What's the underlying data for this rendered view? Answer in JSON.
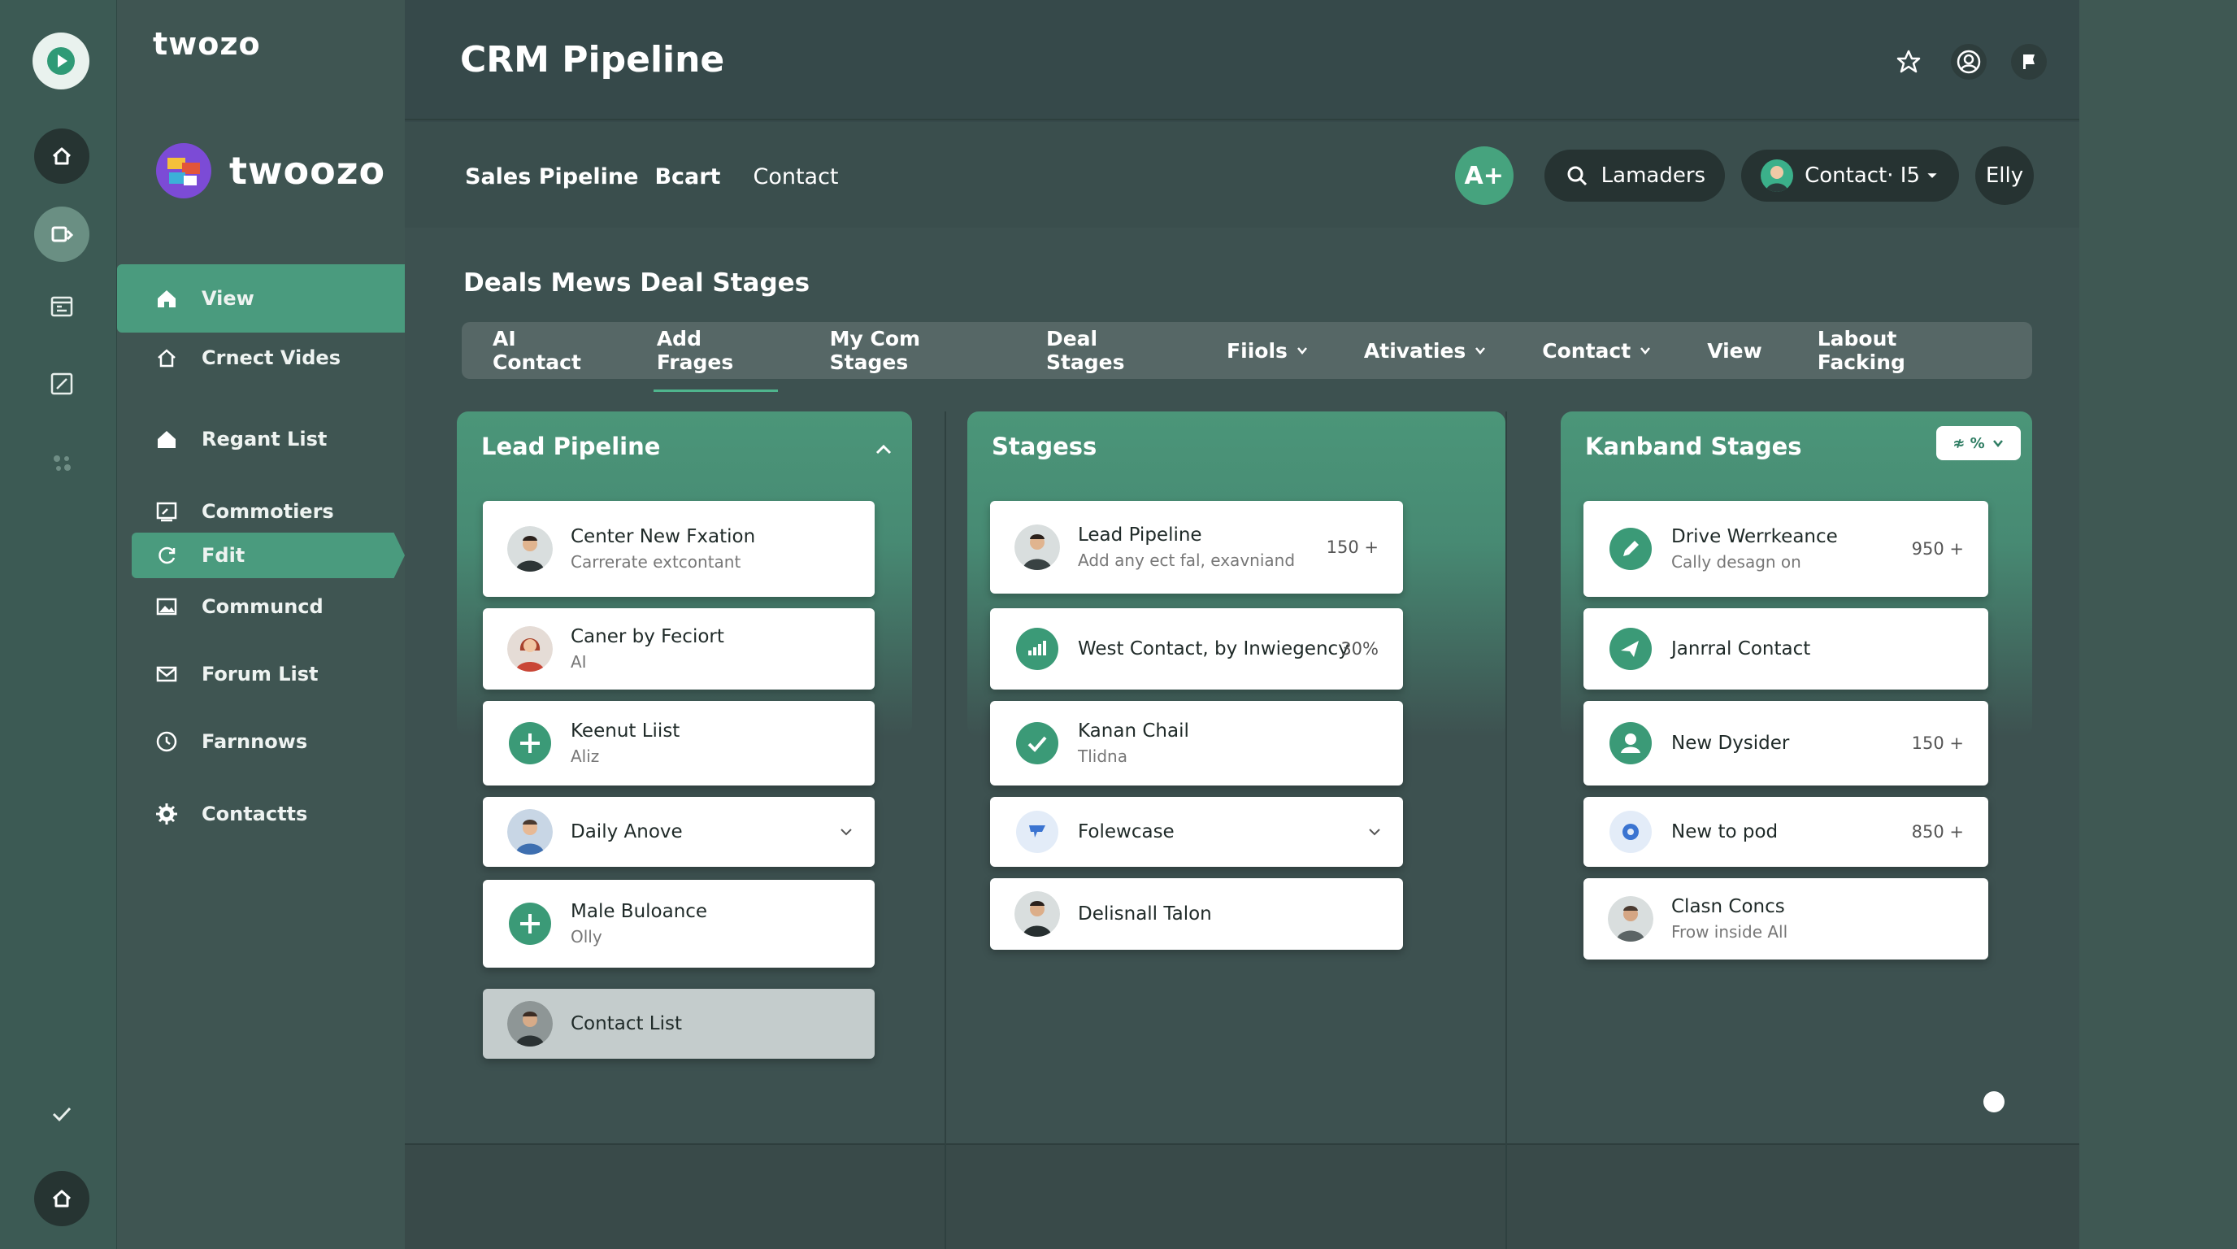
{
  "rail": {
    "icons": [
      "play-icon",
      "home-icon",
      "contacts-card-icon",
      "calendar-icon",
      "edit-icon",
      "dots-icon",
      "check-icon",
      "home-icon"
    ]
  },
  "sidebar": {
    "top_brand": "twozo",
    "brand": "twoozo",
    "items": [
      {
        "label": "View",
        "icon": "home-icon"
      },
      {
        "label": "Crnect Vides",
        "icon": "house-outline-icon"
      },
      {
        "label": "Regant List",
        "icon": "house-filled-icon"
      },
      {
        "label": "Commotiers",
        "icon": "board-icon"
      },
      {
        "label": "Fdit",
        "icon": "refresh-icon"
      },
      {
        "label": "Communcd",
        "icon": "image-icon"
      },
      {
        "label": "Forum List",
        "icon": "mail-icon"
      },
      {
        "label": "Farnnows",
        "icon": "clock-icon"
      },
      {
        "label": "Contactts",
        "icon": "gear-icon"
      }
    ]
  },
  "header": {
    "title": "CRM Pipeline",
    "icons": [
      "star-icon",
      "user-circle-icon",
      "flag-icon"
    ]
  },
  "subbar": {
    "links": [
      "Sales Pipeline",
      "Bcart",
      "Contact"
    ],
    "add_label": "A+",
    "search_label": "Lamaders",
    "contact_label": "Contact· I5",
    "user_label": "Elly"
  },
  "main": {
    "section_title": "Deals Mews Deal Stages",
    "tabs": [
      {
        "label": "AI Contact",
        "dropdown": false
      },
      {
        "label": "Add Frages",
        "dropdown": false,
        "active": true
      },
      {
        "label": "My Com Stages",
        "dropdown": false
      },
      {
        "label": "Deal Stages",
        "dropdown": false
      },
      {
        "label": "Fiiols",
        "dropdown": true
      },
      {
        "label": "Ativaties",
        "dropdown": true
      },
      {
        "label": "Contact",
        "dropdown": true
      },
      {
        "label": "View",
        "dropdown": false
      },
      {
        "label": "Labout Facking",
        "dropdown": false
      }
    ]
  },
  "columns": [
    {
      "title": "Lead Pipeline",
      "cards": [
        {
          "title": "Center New Fxation",
          "subtitle": "Carrerate extcontant",
          "icon": "avatar-man-icon"
        },
        {
          "title": "Caner by Feciort",
          "subtitle": "AI",
          "icon": "avatar-woman-icon"
        },
        {
          "title": "Keenut Liist",
          "subtitle": "Aliz",
          "icon": "plus-circle-icon"
        },
        {
          "title": "Daily Anove",
          "subtitle": "",
          "icon": "avatar-man-blue-icon",
          "dropdown": true
        },
        {
          "title": "Male Buloance",
          "subtitle": "Olly",
          "icon": "plus-circle-icon"
        },
        {
          "title": "Contact List",
          "subtitle": "",
          "icon": "avatar-man-icon"
        }
      ]
    },
    {
      "title": "Stagess",
      "cards": [
        {
          "title": "Lead Pipeline",
          "subtitle": "Add any ect fal, exavniand",
          "meta": "150 +",
          "icon": "avatar-man-icon"
        },
        {
          "title": "West Contact, by Inwiegency",
          "subtitle": "",
          "meta": "30%",
          "icon": "bar-chart-icon"
        },
        {
          "title": "Kanan Chail",
          "subtitle": "Tlidna",
          "icon": "check-circle-icon"
        },
        {
          "title": "Folewcase",
          "subtitle": "",
          "icon": "chat-icon",
          "dropdown": true
        },
        {
          "title": "Delisnall Talon",
          "subtitle": "",
          "icon": "avatar-man-icon"
        }
      ]
    },
    {
      "title": "Kanband Stages",
      "filter_label": "≉ %",
      "cards": [
        {
          "title": "Drive Werrkeance",
          "subtitle": "Cally desagn on",
          "meta": "950 +",
          "icon": "edit-circle-icon"
        },
        {
          "title": "Janrral Contact",
          "subtitle": "",
          "icon": "send-circle-icon"
        },
        {
          "title": "New Dysider",
          "subtitle": "",
          "meta": "150 +",
          "icon": "user-circle-icon"
        },
        {
          "title": "New to pod",
          "subtitle": "",
          "meta": "850 +",
          "icon": "gear-blue-icon"
        },
        {
          "title": "Clasn Concs",
          "subtitle": "Frow inside All",
          "icon": "avatar-man-icon"
        }
      ]
    }
  ],
  "colors": {
    "accent": "#4a9b7e",
    "sidebar": "#3f5552",
    "rail": "#3c5a54",
    "background": "#36494a"
  }
}
